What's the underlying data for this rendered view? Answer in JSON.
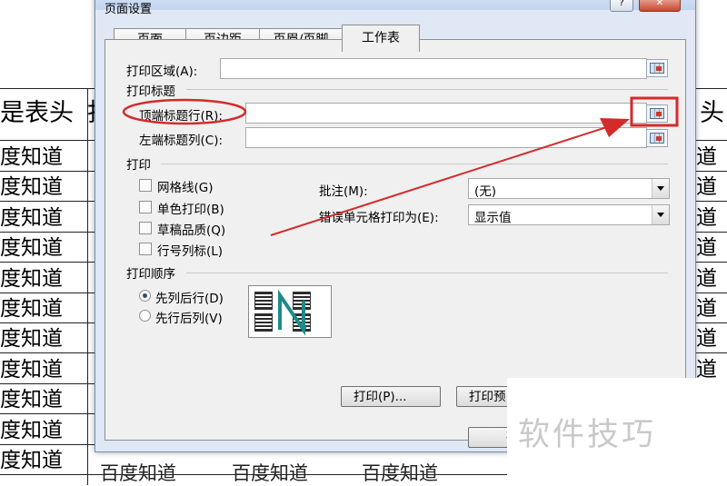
{
  "sheet": {
    "left_header": "是表头",
    "left_header_partial": "打",
    "right_header": "头",
    "left_cells": [
      "度知道",
      "度知道",
      "度知道",
      "度知道",
      "度知道",
      "度知道",
      "度知道",
      "度知道",
      "度知道",
      "度知道",
      "度知道"
    ],
    "right_cells": [
      "道",
      "道",
      "道",
      "道",
      "道",
      "道",
      "道",
      "道"
    ],
    "bottom_row": [
      "百度知道",
      "百度知道",
      "百度知道"
    ]
  },
  "dialog": {
    "title": "页面设置",
    "tabs": [
      {
        "label": "页面",
        "active": false
      },
      {
        "label": "页边距",
        "active": false
      },
      {
        "label": "页眉/页脚",
        "active": false
      },
      {
        "label": "工作表",
        "active": true
      }
    ],
    "print_area_label": "打印区域(A):",
    "print_titles_section": "打印标题",
    "top_rows_label": "顶端标题行(R):",
    "left_cols_label": "左端标题列(C):",
    "print_section": "打印",
    "checkboxes": [
      {
        "label": "网格线(G)",
        "checked": false
      },
      {
        "label": "单色打印(B)",
        "checked": false
      },
      {
        "label": "草稿品质(Q)",
        "checked": false
      },
      {
        "label": "行号列标(L)",
        "checked": false
      }
    ],
    "comments_label": "批注(M):",
    "comments_value": "(无)",
    "errors_label": "错误单元格打印为(E):",
    "errors_value": "显示值",
    "print_order_section": "打印顺序",
    "radios": [
      {
        "label": "先列后行(D)",
        "selected": true
      },
      {
        "label": "先行后列(V)",
        "selected": false
      }
    ],
    "print_button": "打印(P)...",
    "preview_button": "打印预",
    "ok_button": "确"
  },
  "watermark": "软件技巧",
  "colors": {
    "annotation": "#d42a2a",
    "dialog_bg": "#dfe8f4"
  }
}
